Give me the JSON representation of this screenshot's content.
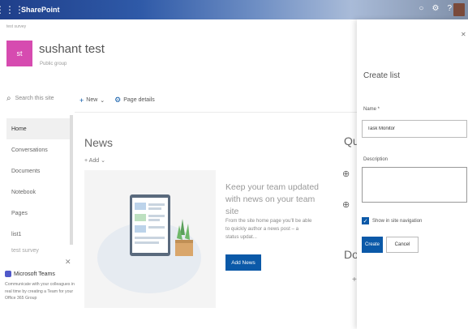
{
  "suitebar": {
    "app_name": "SharePoint",
    "icons": [
      "settings-icon",
      "help-icon",
      "notifications-icon"
    ],
    "accent": "#1f3f8a"
  },
  "site": {
    "breadcrumb": "test survey",
    "logo_initials": "st",
    "logo_color": "#d64bb0",
    "title": "sushant test",
    "subtitle": "Public group"
  },
  "leftnav": {
    "search_placeholder": "Search this site",
    "items": [
      {
        "label": "Home",
        "active": true
      },
      {
        "label": "Conversations"
      },
      {
        "label": "Documents"
      },
      {
        "label": "Notebook"
      },
      {
        "label": "Pages"
      },
      {
        "label": "list1"
      },
      {
        "label": "test survey"
      }
    ]
  },
  "teams_promo": {
    "title": "Microsoft Teams",
    "text": "Communicate with your colleagues in real time by creating a Team for your Office 365 Group"
  },
  "commandbar": {
    "new_label": "New",
    "page_details_label": "Page details"
  },
  "news": {
    "title": "News",
    "add_label": "Add",
    "heading": "Keep your team updated with news on your team site",
    "body": "From the site home page you'll be able to quickly author a news post – a status updat...",
    "add_news_button": "Add News"
  },
  "peek": {
    "quick_links": "Qui",
    "documents": "Doc"
  },
  "panel": {
    "title": "Create list",
    "name_label": "Name *",
    "name_value": "Task Monitor",
    "description_label": "Description",
    "description_value": "",
    "show_in_nav_label": "Show in site navigation",
    "show_in_nav_checked": true,
    "create_label": "Create",
    "cancel_label": "Cancel",
    "primary_color": "#0b59a8"
  }
}
